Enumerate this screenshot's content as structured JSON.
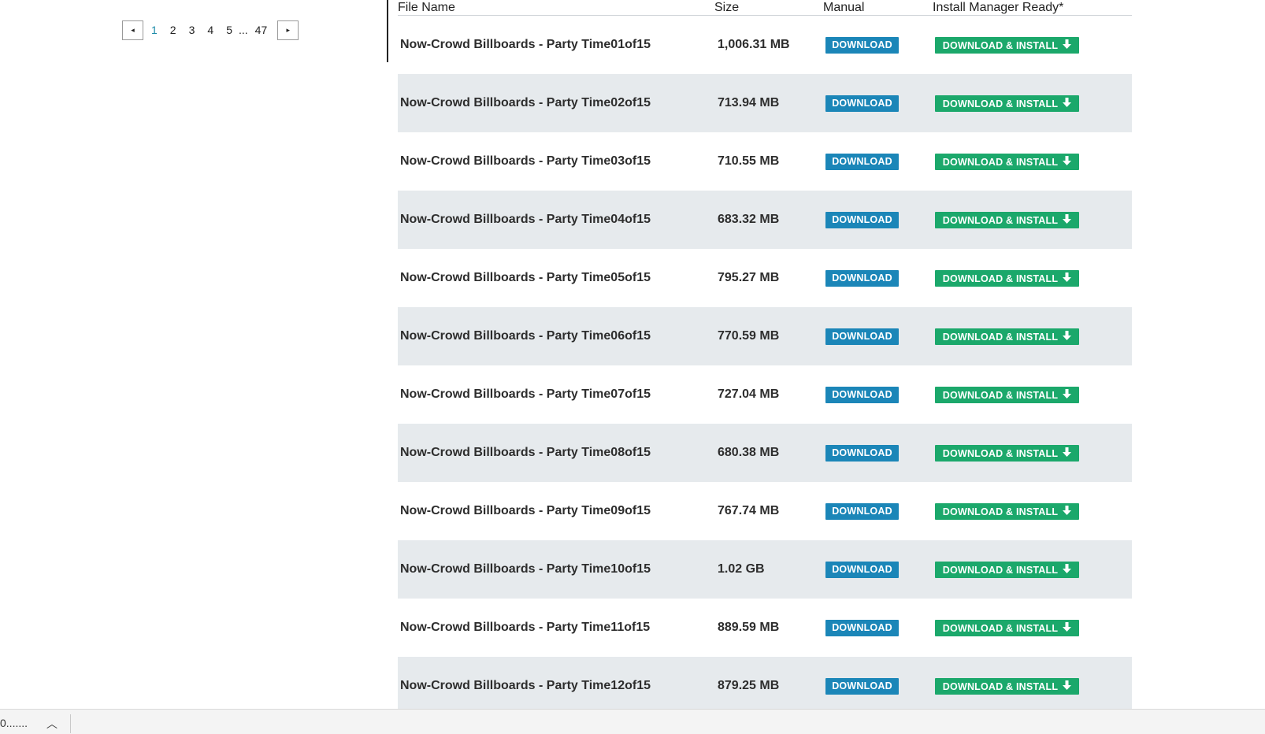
{
  "pagination": {
    "prev_icon": "◂",
    "next_icon": "▸",
    "pages": [
      "1",
      "2",
      "3",
      "4",
      "5"
    ],
    "ellipsis": "...",
    "last_page": "47",
    "active_page": "1"
  },
  "table": {
    "headers": {
      "file_name": "File Name",
      "size": "Size",
      "manual": "Manual",
      "install_manager": "Install Manager Ready*"
    },
    "download_label": "DOWNLOAD",
    "install_label": "DOWNLOAD & INSTALL",
    "install_icon": "arrow-down-icon",
    "rows": [
      {
        "name": "Now-Crowd Billboards - Party Time01of15",
        "size": "1,006.31 MB"
      },
      {
        "name": "Now-Crowd Billboards - Party Time02of15",
        "size": "713.94 MB"
      },
      {
        "name": "Now-Crowd Billboards - Party Time03of15",
        "size": "710.55 MB"
      },
      {
        "name": "Now-Crowd Billboards - Party Time04of15",
        "size": "683.32 MB"
      },
      {
        "name": "Now-Crowd Billboards - Party Time05of15",
        "size": "795.27 MB"
      },
      {
        "name": "Now-Crowd Billboards - Party Time06of15",
        "size": "770.59 MB"
      },
      {
        "name": "Now-Crowd Billboards - Party Time07of15",
        "size": "727.04 MB"
      },
      {
        "name": "Now-Crowd Billboards - Party Time08of15",
        "size": "680.38 MB"
      },
      {
        "name": "Now-Crowd Billboards - Party Time09of15",
        "size": "767.74 MB"
      },
      {
        "name": "Now-Crowd Billboards - Party Time10of15",
        "size": "1.02 GB"
      },
      {
        "name": "Now-Crowd Billboards - Party Time11of15",
        "size": "889.59 MB"
      },
      {
        "name": "Now-Crowd Billboards - Party Time12of15",
        "size": "879.25 MB"
      }
    ]
  },
  "download_bar": {
    "item_text": "0.......",
    "chevron": "︿"
  },
  "colors": {
    "download_button": "#1b86b8",
    "install_button": "#1ba86b",
    "alt_row": "#e6eaed",
    "active_page": "#1a8aa8"
  }
}
